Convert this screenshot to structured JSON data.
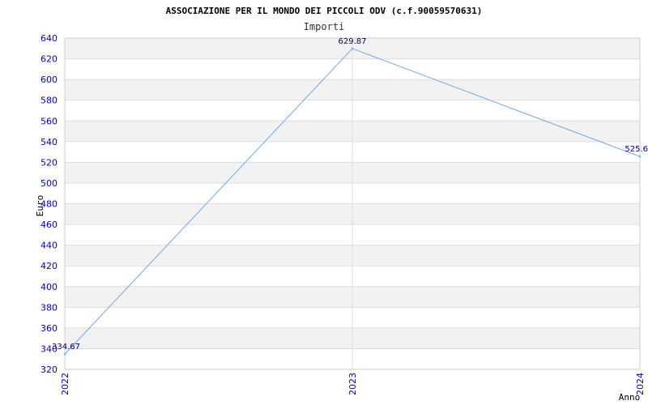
{
  "chart_data": {
    "type": "line",
    "title": "ASSOCIAZIONE PER IL MONDO DEI PICCOLI ODV (c.f.90059570631)",
    "subtitle": "Importi",
    "xlabel": "Anno",
    "ylabel": "Euro",
    "categories": [
      "2022",
      "2023",
      "2024"
    ],
    "series": [
      {
        "values": [
          334.67,
          629.87,
          525.6
        ]
      }
    ],
    "data_labels": [
      "334.67",
      "629.87",
      "525.6"
    ],
    "ylim": [
      320,
      640
    ],
    "yticks": [
      "320",
      "340",
      "360",
      "380",
      "400",
      "420",
      "440",
      "460",
      "480",
      "500",
      "520",
      "540",
      "560",
      "580",
      "600",
      "620",
      "640"
    ],
    "grid": true,
    "colors": {
      "line": "#6aaaf0",
      "band": "#f2f2f2",
      "tick_text": "#0000cc",
      "data_label": "#000080"
    }
  }
}
